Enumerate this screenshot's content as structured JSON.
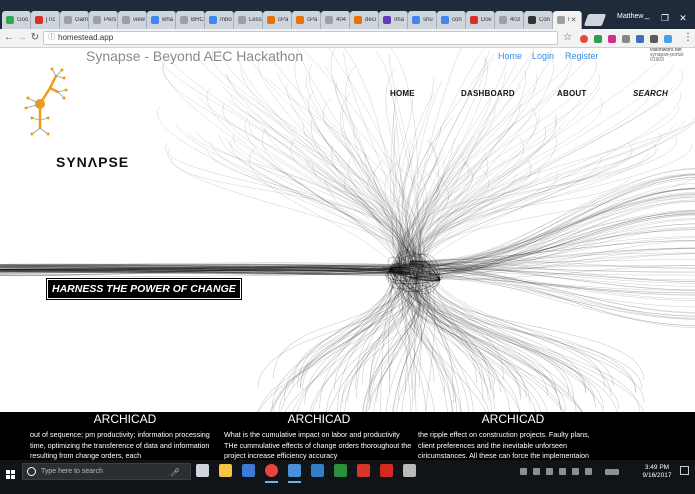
{
  "browser": {
    "tabs": [
      {
        "title": "Goo",
        "color": "#34a853"
      },
      {
        "title": "[Tic",
        "color": "#d93025"
      },
      {
        "title": "Gam",
        "color": "#9aa0a6"
      },
      {
        "title": "Pers",
        "color": "#9aa0a6"
      },
      {
        "title": "view",
        "color": "#9aa0a6"
      },
      {
        "title": "wha",
        "color": "#4285f4"
      },
      {
        "title": "BRC",
        "color": "#9aa0a6"
      },
      {
        "title": "Inbo",
        "color": "#4285f4"
      },
      {
        "title": "Less",
        "color": "#9aa0a6"
      },
      {
        "title": "cPa",
        "color": "#e8710a"
      },
      {
        "title": "cPa",
        "color": "#e8710a"
      },
      {
        "title": "404",
        "color": "#9aa0a6"
      },
      {
        "title": "deci",
        "color": "#e8710a"
      },
      {
        "title": "Ima",
        "color": "#673ab7"
      },
      {
        "title": "shu",
        "color": "#4285f4"
      },
      {
        "title": "con",
        "color": "#4285f4"
      },
      {
        "title": "Dov",
        "color": "#d93025"
      },
      {
        "title": "403",
        "color": "#9aa0a6"
      },
      {
        "title": "Con",
        "color": "#333333"
      },
      {
        "title": "I",
        "color": "#9aa0a6",
        "active": true
      }
    ],
    "profile_name": "Matthew",
    "url": "homestead.app",
    "window_controls": [
      "–",
      "❐",
      "✕"
    ]
  },
  "site": {
    "title": "Synapse - Beyond AEC Hackathon",
    "auth_links": [
      "Home",
      "Login",
      "Register"
    ],
    "watermark_line1": "visionworx.net",
    "watermark_line2": "synapse-portal-01903",
    "nav": [
      "HOME",
      "DASHBOARD",
      "ABOUT",
      "SEARCH"
    ],
    "brand": "SYNΛPSE",
    "tagline": "HARNESS THE POWER OF CHANGE",
    "accent_color": "#f39c12"
  },
  "features": [
    {
      "title": "ARCHICAD",
      "body": "out of sequence; pm productivity; information processing time, optimizing the transference of data and information resulting from change orders, each"
    },
    {
      "title": "ARCHICAD",
      "body": "What is the cumulative impact on labor and productivity THe cummulative effects of change orders thoroughout the project increase efficiency accuracy"
    },
    {
      "title": "ARCHICAD",
      "body": "the ripple effect on construction projects. Faulty plans, client preferences and the inevitable unforseen ciricumstances. All these can force the implementaion"
    }
  ],
  "taskbar": {
    "search_placeholder": "Type here to search",
    "time": "3:49 PM",
    "date": "9/16/2017",
    "pinned_apps": [
      {
        "name": "task-view-icon",
        "color": "#cfd5dd"
      },
      {
        "name": "file-explorer-icon",
        "color": "#f6c342"
      },
      {
        "name": "store-icon",
        "color": "#3a7bd5"
      },
      {
        "name": "chrome-icon",
        "color": "#e8453c"
      },
      {
        "name": "mail-icon",
        "color": "#4a90d9"
      },
      {
        "name": "photos-icon",
        "color": "#2f80c9"
      },
      {
        "name": "grasshopper-icon",
        "color": "#2c8f3c"
      },
      {
        "name": "sketchup-icon",
        "color": "#d9362b"
      },
      {
        "name": "acrobat-icon",
        "color": "#d32a1f"
      },
      {
        "name": "cube-app-icon",
        "color": "#b9b9b9"
      }
    ]
  }
}
